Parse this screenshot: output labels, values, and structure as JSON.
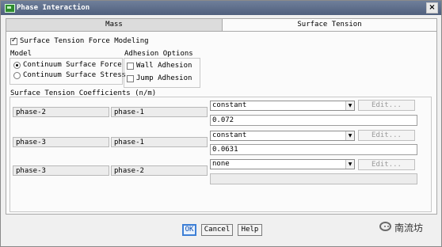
{
  "window": {
    "title": "Phase Interaction",
    "close_glyph": "×"
  },
  "tabs": [
    {
      "label": "Mass"
    },
    {
      "label": "Surface Tension"
    }
  ],
  "modeling": {
    "label": "Surface Tension Force Modeling",
    "checked": true
  },
  "model": {
    "heading": "Model",
    "options": [
      {
        "label": "Continuum Surface Force",
        "selected": true
      },
      {
        "label": "Continuum Surface Stress",
        "selected": false
      }
    ]
  },
  "adhesion": {
    "heading": "Adhesion Options",
    "options": [
      {
        "label": "Wall Adhesion",
        "checked": false
      },
      {
        "label": "Jump Adhesion",
        "checked": false
      }
    ]
  },
  "coefficients": {
    "heading": "Surface Tension Coefficients (n/m)",
    "rows": [
      {
        "phase_a": "phase-2",
        "phase_b": "phase-1",
        "method": "constant",
        "edit": "Edit...",
        "value": "0.072"
      },
      {
        "phase_a": "phase-3",
        "phase_b": "phase-1",
        "method": "constant",
        "edit": "Edit...",
        "value": "0.0631"
      },
      {
        "phase_a": "phase-3",
        "phase_b": "phase-2",
        "method": "none",
        "edit": "Edit...",
        "value": ""
      }
    ]
  },
  "buttons": {
    "ok": "OK",
    "cancel": "Cancel",
    "help": "Help"
  },
  "watermark": {
    "text": "南流坊"
  },
  "icons": {
    "dropdown": "dropdown-arrow-icon",
    "app": "fluent-app-icon",
    "watermark": "wechat-icon"
  }
}
